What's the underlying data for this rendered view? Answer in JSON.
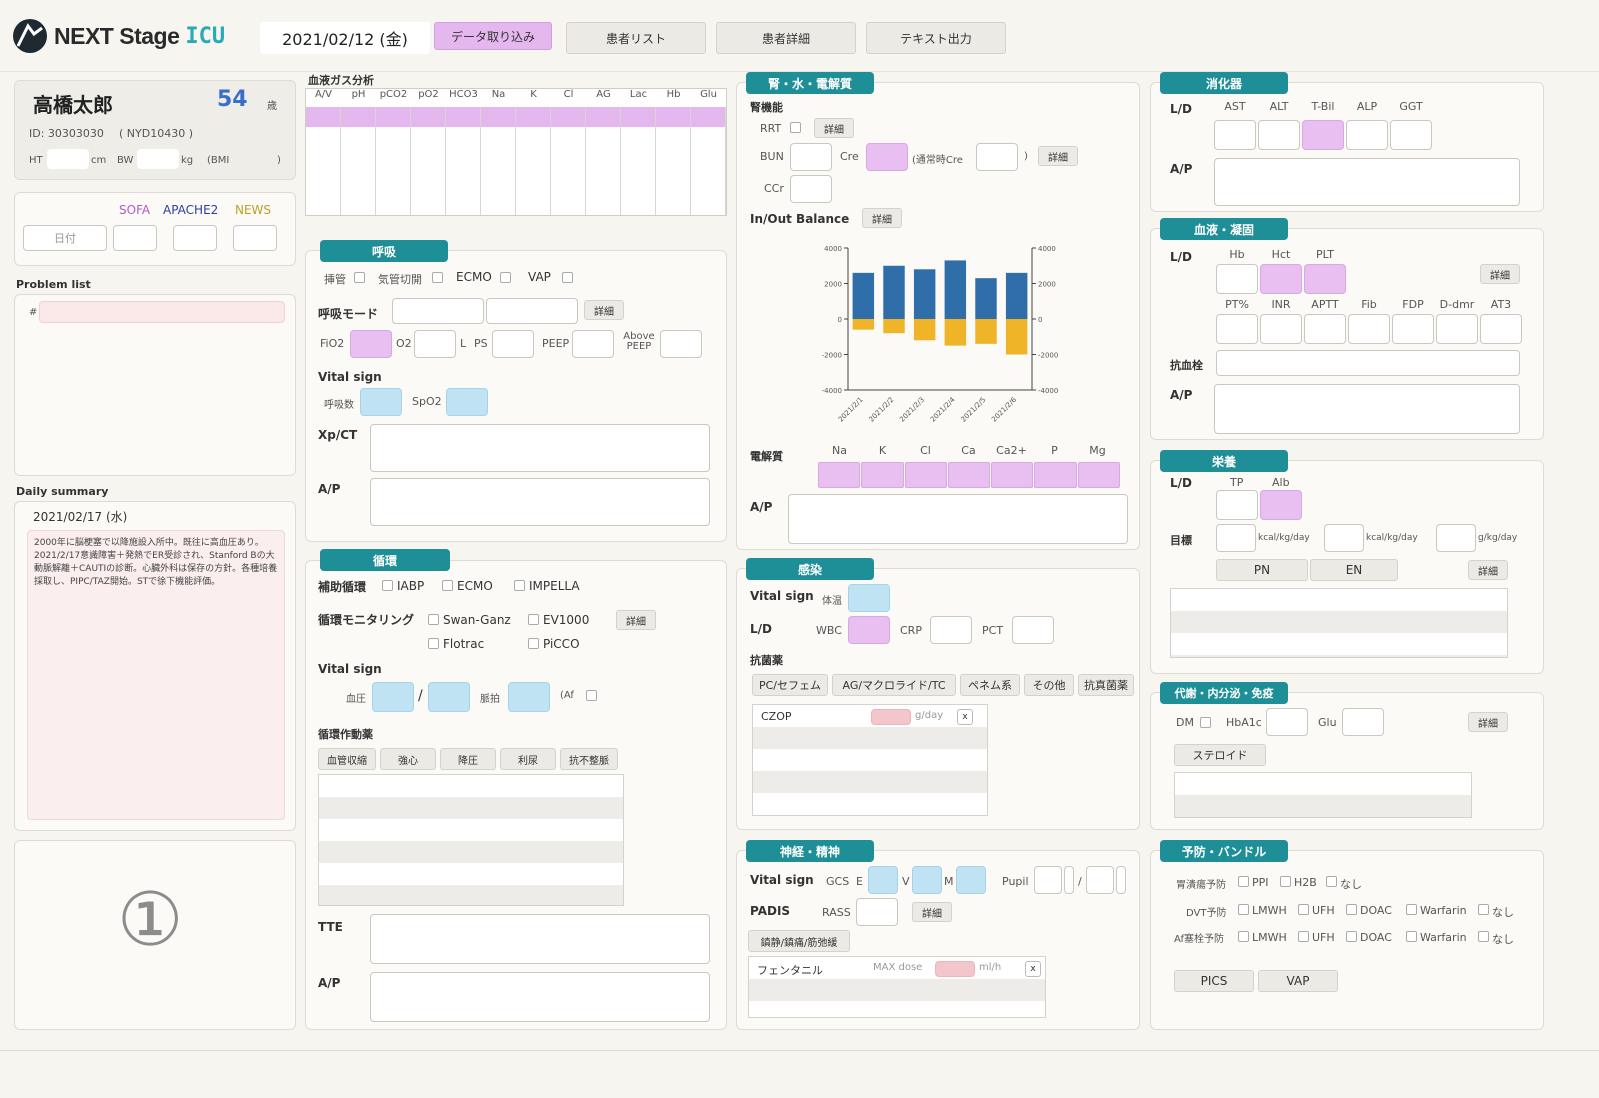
{
  "header": {
    "logo_text": "NEXT Stage",
    "logo_icu": "ICU",
    "date": "2021/02/12 (金)",
    "import_btn": "データ取り込み",
    "patient_list_btn": "患者リスト",
    "patient_detail_btn": "患者詳細",
    "text_export_btn": "テキスト出力"
  },
  "patient": {
    "name": "高橋太郎",
    "age": "54",
    "age_unit": "歳",
    "id": "ID: 30303030",
    "code": "(  NYD10430  )",
    "ht": "HT",
    "cm": "cm",
    "bw": "BW",
    "kg": "kg",
    "bmi": "(BMI",
    "bmi_close": ")"
  },
  "scores": {
    "sofa": "SOFA",
    "apache": "APACHE2",
    "news": "NEWS",
    "date_placeholder": "日付",
    "sofa_color": "#b05cc8",
    "apache_color": "#2b3fa0",
    "news_color": "#b9a12a"
  },
  "problem": {
    "title": "Problem list",
    "hash": "#"
  },
  "daily": {
    "title": "Daily summary",
    "date": "2021/02/17 (水)",
    "text": "2000年に脳梗塞で以降施設入所中。既往に高血圧あり。2021/2/17意識障害＋発熱でER受診され、Stanford Bの大動脈解離＋CAUTIの診断。心臓外科は保存の方針。各種培養採取し、PIPC/TAZ開始。STで徐下機能評価。"
  },
  "marker": "①",
  "gas": {
    "title": "血液ガス分析",
    "cols": [
      "A/V",
      "pH",
      "pCO2",
      "pO2",
      "HCO3",
      "Na",
      "K",
      "Cl",
      "AG",
      "Lac",
      "Hb",
      "Glu"
    ]
  },
  "resp": {
    "chip": "呼吸",
    "intubation": "挿管",
    "tracheostomy": "気管切開",
    "ecmo": "ECMO",
    "vap": "VAP",
    "mode": "呼吸モード",
    "detail": "詳細",
    "fio2": "FiO2",
    "o2": "O2",
    "l": "L",
    "ps": "PS",
    "peep": "PEEP",
    "above_peep": "Above PEEP",
    "vital": "Vital sign",
    "rr": "呼吸数",
    "spo2": "SpO2",
    "xp": "Xp/CT",
    "ap": "A/P"
  },
  "circ": {
    "chip": "循環",
    "assist": "補助循環",
    "iabp": "IABP",
    "ecmo": "ECMO",
    "impella": "IMPELLA",
    "monitor": "循環モニタリング",
    "swan": "Swan-Ganz",
    "ev": "EV1000",
    "flotrac": "Flotrac",
    "picco": "PiCCO",
    "detail": "詳細",
    "vital": "Vital sign",
    "bp": "血圧",
    "slash": "/",
    "hr": "脈拍",
    "af": "(Af",
    "drugs": "循環作動薬",
    "vaso": "血管収縮",
    "inotrope": "強心",
    "hypotensive": "降圧",
    "diuretic": "利尿",
    "antiarrhythmic": "抗不整脈",
    "tte": "TTE",
    "ap": "A/P"
  },
  "renal": {
    "chip": "腎・水・電解質",
    "func": "腎機能",
    "rrt": "RRT",
    "detail": "詳細",
    "bun": "BUN",
    "cre": "Cre",
    "normal_cre": "(通常時Cre",
    "close": ")",
    "ccr": "CCr",
    "io": "In/Out Balance",
    "lytes": "電解質",
    "lyte_cols": [
      "Na",
      "K",
      "Cl",
      "Ca",
      "Ca2+",
      "P",
      "Mg"
    ],
    "ap": "A/P"
  },
  "chart_data": {
    "type": "bar",
    "categories": [
      "2021/2/1",
      "2021/2/2",
      "2021/2/3",
      "2021/2/4",
      "2021/2/5",
      "2021/2/6"
    ],
    "series": [
      {
        "values": [
          2600,
          3000,
          2800,
          3300,
          2300,
          2600
        ],
        "color": "#2f6ea8"
      },
      {
        "values": [
          -600,
          -800,
          -1200,
          -1500,
          -1400,
          -2000
        ],
        "color": "#f0b429"
      }
    ],
    "ylim": [
      -4000,
      4000
    ],
    "yticks": [
      -4000,
      -2000,
      0,
      2000,
      4000
    ],
    "stacked": true
  },
  "infection": {
    "chip": "感染",
    "vital": "Vital sign",
    "temp": "体温",
    "ld": "L/D",
    "wbc": "WBC",
    "crp": "CRP",
    "pct": "PCT",
    "abx": "抗菌薬",
    "tabs": [
      "PC/セフェム",
      "AG/マクロライド/TC",
      "ペネム系",
      "その他",
      "抗真菌薬"
    ],
    "drug": "CZOP",
    "unit": "g/day",
    "x": "x"
  },
  "neuro": {
    "chip": "神経・精神",
    "vital": "Vital sign",
    "gcs": "GCS",
    "e": "E",
    "v": "V",
    "m": "M",
    "pupil": "Pupil",
    "slash": "/",
    "padis": "PADIS",
    "rass": "RASS",
    "detail": "詳細",
    "sedation": "鎮静/鎮痛/筋弛緩",
    "drug": "フェンタニル",
    "max": "MAX dose",
    "unit": "ml/h",
    "x": "x"
  },
  "gi": {
    "chip": "消化器",
    "ld": "L/D",
    "cols": [
      "AST",
      "ALT",
      "T-Bil",
      "ALP",
      "GGT"
    ],
    "ap": "A/P"
  },
  "blood": {
    "chip": "血液・凝固",
    "ld": "L/D",
    "row1": [
      "Hb",
      "Hct",
      "PLT"
    ],
    "detail": "詳細",
    "row2": [
      "PT%",
      "INR",
      "APTT",
      "Fib",
      "FDP",
      "D-dmr",
      "AT3"
    ],
    "anticoag": "抗血栓",
    "ap": "A/P"
  },
  "nutrition": {
    "chip": "栄養",
    "ld": "L/D",
    "tp": "TP",
    "alb": "Alb",
    "target": "目標",
    "u1": "kcal/kg/day",
    "u2": "kcal/kg/day",
    "u3": "g/kg/day",
    "pn": "PN",
    "en": "EN",
    "detail": "詳細"
  },
  "metab": {
    "chip": "代謝・内分泌・免疫",
    "dm": "DM",
    "hba1c": "HbA1c",
    "glu": "Glu",
    "detail": "詳細",
    "steroid": "ステロイド"
  },
  "prevent": {
    "chip": "予防・バンドル",
    "ulcer": "胃潰瘍予防",
    "ppi": "PPI",
    "h2b": "H2B",
    "none": "なし",
    "dvt": "DVT予防",
    "af": "Af塞栓予防",
    "lmwh": "LMWH",
    "ufh": "UFH",
    "doac": "DOAC",
    "warfarin": "Warfarin",
    "pics": "PICS",
    "vap": "VAP"
  }
}
